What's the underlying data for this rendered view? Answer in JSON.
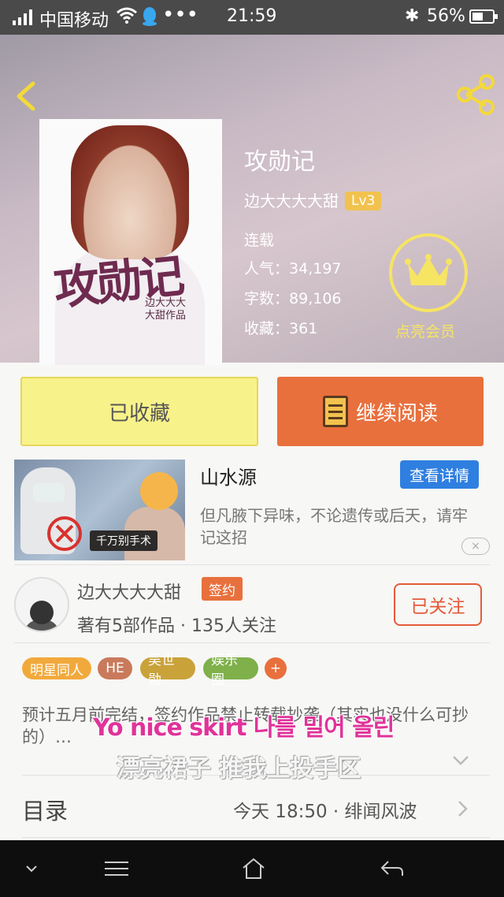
{
  "status_bar": {
    "carrier": "中国移动",
    "dots": "•••",
    "time": "21:59",
    "battery": "56%",
    "battery_level": 0.56
  },
  "book": {
    "title": "攻勋记",
    "author": "边大大大大甜",
    "level": "Lv3",
    "status": "连载",
    "popularity_label": "人气：",
    "popularity": "34,197",
    "words_label": "字数：",
    "words": "89,106",
    "favorites_label": "收藏：",
    "favorites": "361",
    "cover_title": "攻勋记",
    "cover_author": "边大大大大甜作品"
  },
  "vip": {
    "label": "点亮会员"
  },
  "actions": {
    "collected_label": "已收藏",
    "continue_label": "继续阅读"
  },
  "ad": {
    "title": "山水源",
    "button": "查看详情",
    "description": "但凡腋下异味，不论遗传或后天，请牢记这招",
    "image_caption": "千万别手术",
    "close": "×"
  },
  "author": {
    "name": "边大大大大甜",
    "badge": "签约",
    "meta": "著有5部作品 · 135人关注",
    "follow_label": "已关注"
  },
  "tags": [
    {
      "label": "明星同人",
      "color": "#f2a93b"
    },
    {
      "label": "HE",
      "color": "#c97a5b"
    },
    {
      "label": "吴世勋",
      "color": "#c9a23a"
    },
    {
      "label": "娱乐圈",
      "color": "#7fb04a"
    },
    {
      "label": "+",
      "color": "#e8703d"
    }
  ],
  "synopsis": "预计五月前完结，签约作品禁止转载抄袭（其实也没什么可抄的）…",
  "overlay_lyrics": {
    "line1": "Yo nice skirt 나를 밀어 올린",
    "line2": "漂亮裙子 推我上投手区"
  },
  "toc": {
    "label": "目录",
    "latest": "今天 18:50 · 绯闻风波"
  },
  "colors": {
    "accent_orange": "#e8703d",
    "favorite_yellow": "#f8f28a",
    "link_blue": "#2f7fe0",
    "vip_yellow": "#f6e463"
  }
}
